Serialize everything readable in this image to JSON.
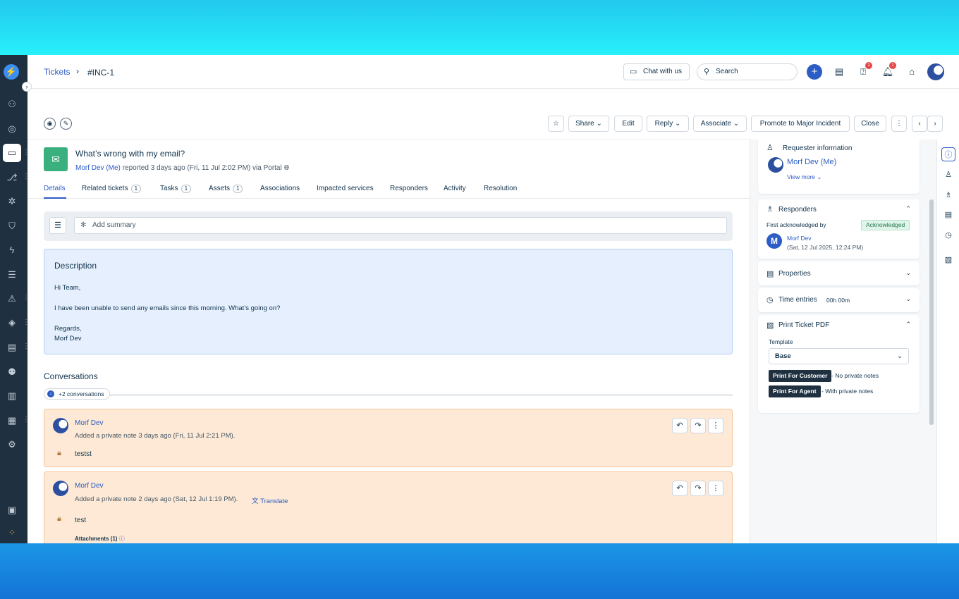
{
  "header": {
    "breadcrumb_link": "Tickets",
    "breadcrumb_sep": "›",
    "breadcrumb_current": "#INC-1",
    "chat_label": "Chat with us",
    "search_placeholder": "Search",
    "help_badge": "1",
    "notif_badge": "1"
  },
  "toolbar": {
    "share": "Share",
    "edit": "Edit",
    "reply": "Reply",
    "associate": "Associate",
    "promote": "Promote to Major Incident",
    "close": "Close"
  },
  "ticket": {
    "subject": "What’s wrong with my email?",
    "requester": "Morf Dev (Me)",
    "reported": "reported 3 days ago (Fri, 11 Jul 2:02 PM) via Portal"
  },
  "tabs": [
    {
      "label": "Details"
    },
    {
      "label": "Related tickets",
      "count": "1"
    },
    {
      "label": "Tasks",
      "count": "1"
    },
    {
      "label": "Assets",
      "count": "1"
    },
    {
      "label": "Associations"
    },
    {
      "label": "Impacted services"
    },
    {
      "label": "Responders"
    },
    {
      "label": "Activity"
    },
    {
      "label": "Resolution"
    }
  ],
  "summary": {
    "placeholder": "Add summary"
  },
  "description": {
    "title": "Description",
    "lines": [
      "Hi Team,",
      "I have been unable to send any emails since this morning. What’s going on?",
      "Regards,",
      "Morf Dev"
    ]
  },
  "conversations": {
    "title": "Conversations",
    "more": "+2 conversations",
    "notes": [
      {
        "author": "Morf Dev",
        "meta": "Added a private note 3 days ago (Fri, 11 Jul 2:21 PM).",
        "body": "testst"
      },
      {
        "author": "Morf Dev",
        "meta": "Added a private note 2 days ago (Sat, 12 Jul 1:19 PM).",
        "translate": "Translate",
        "body": "test",
        "attachments": "Attachments (1)"
      }
    ]
  },
  "right_panel": {
    "requester_title": "Requester information",
    "requester_name": "Morf Dev (Me)",
    "view_more": "View more",
    "responders_title": "Responders",
    "first_ack": "First acknowledged by",
    "ack_badge": "Acknowledged",
    "responder_initial": "M",
    "responder_name": "Morf Dev",
    "responder_time": "(Sat, 12 Jul 2025, 12:24 PM)",
    "properties_title": "Properties",
    "time_title": "Time entries",
    "time_value": "00h 00m",
    "print_title": "Print Ticket PDF",
    "template_label": "Template",
    "template_value": "Base",
    "print_customer": "Print For Customer",
    "print_customer_note": "- No private notes",
    "print_agent": "Print For Agent",
    "print_agent_note": "- With private notes"
  },
  "colors": {
    "accent": "#2c5cc5",
    "sidebar": "#1f3041",
    "note_bg": "#fde9d5",
    "desc_bg": "#e5effd",
    "ticket_icon": "#3bb07f"
  }
}
